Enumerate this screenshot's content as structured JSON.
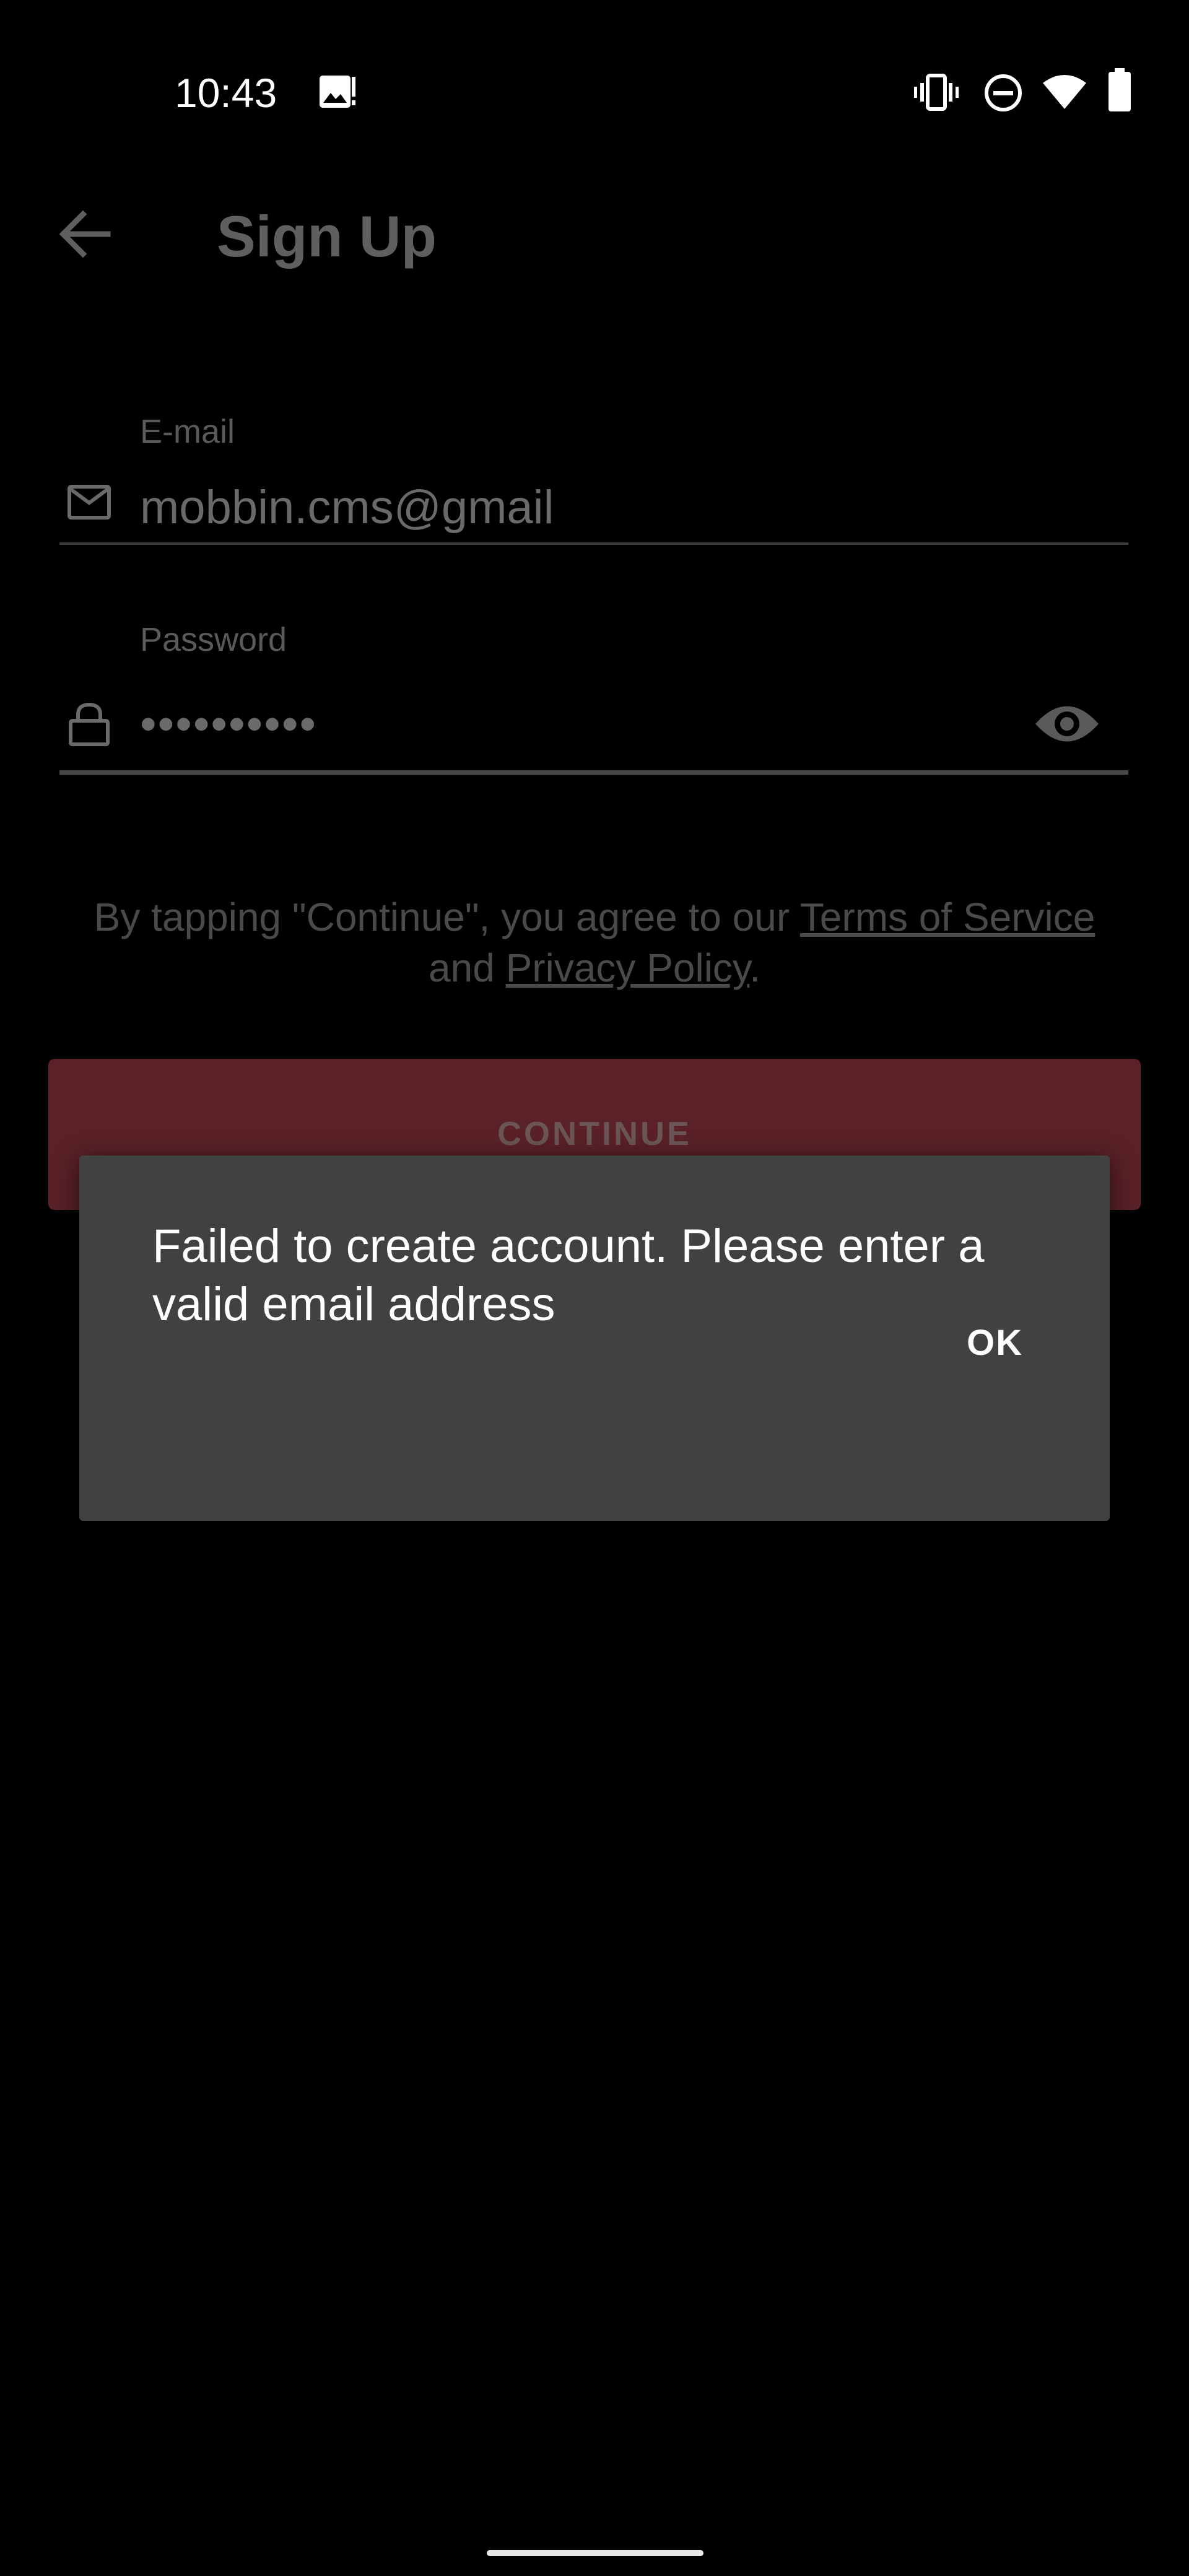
{
  "status_bar": {
    "time": "10:43",
    "icons": [
      "image-notification-icon",
      "vibrate-icon",
      "do-not-disturb-icon",
      "wifi-icon",
      "battery-icon"
    ]
  },
  "header": {
    "title": "Sign Up",
    "back_icon": "arrow-left-icon"
  },
  "form": {
    "email": {
      "label": "E-mail",
      "value": "mobbin.cms@gmail",
      "icon": "mail-icon"
    },
    "password": {
      "label": "Password",
      "value": "••••••••••",
      "icon": "lock-icon",
      "toggle_icon": "eye-icon"
    }
  },
  "terms": {
    "prefix": "By tapping \"Continue\", you agree to our ",
    "terms_link": "Terms of Service",
    "middle": " and ",
    "privacy_link": "Privacy Policy",
    "suffix": "."
  },
  "continue_button": {
    "label": "CONTINUE"
  },
  "dialog": {
    "message": "Failed to create account. Please enter a valid email address",
    "ok_label": "OK"
  },
  "colors": {
    "background": "#000000",
    "dialog": "#414141",
    "continue_button": "#5a2128"
  }
}
